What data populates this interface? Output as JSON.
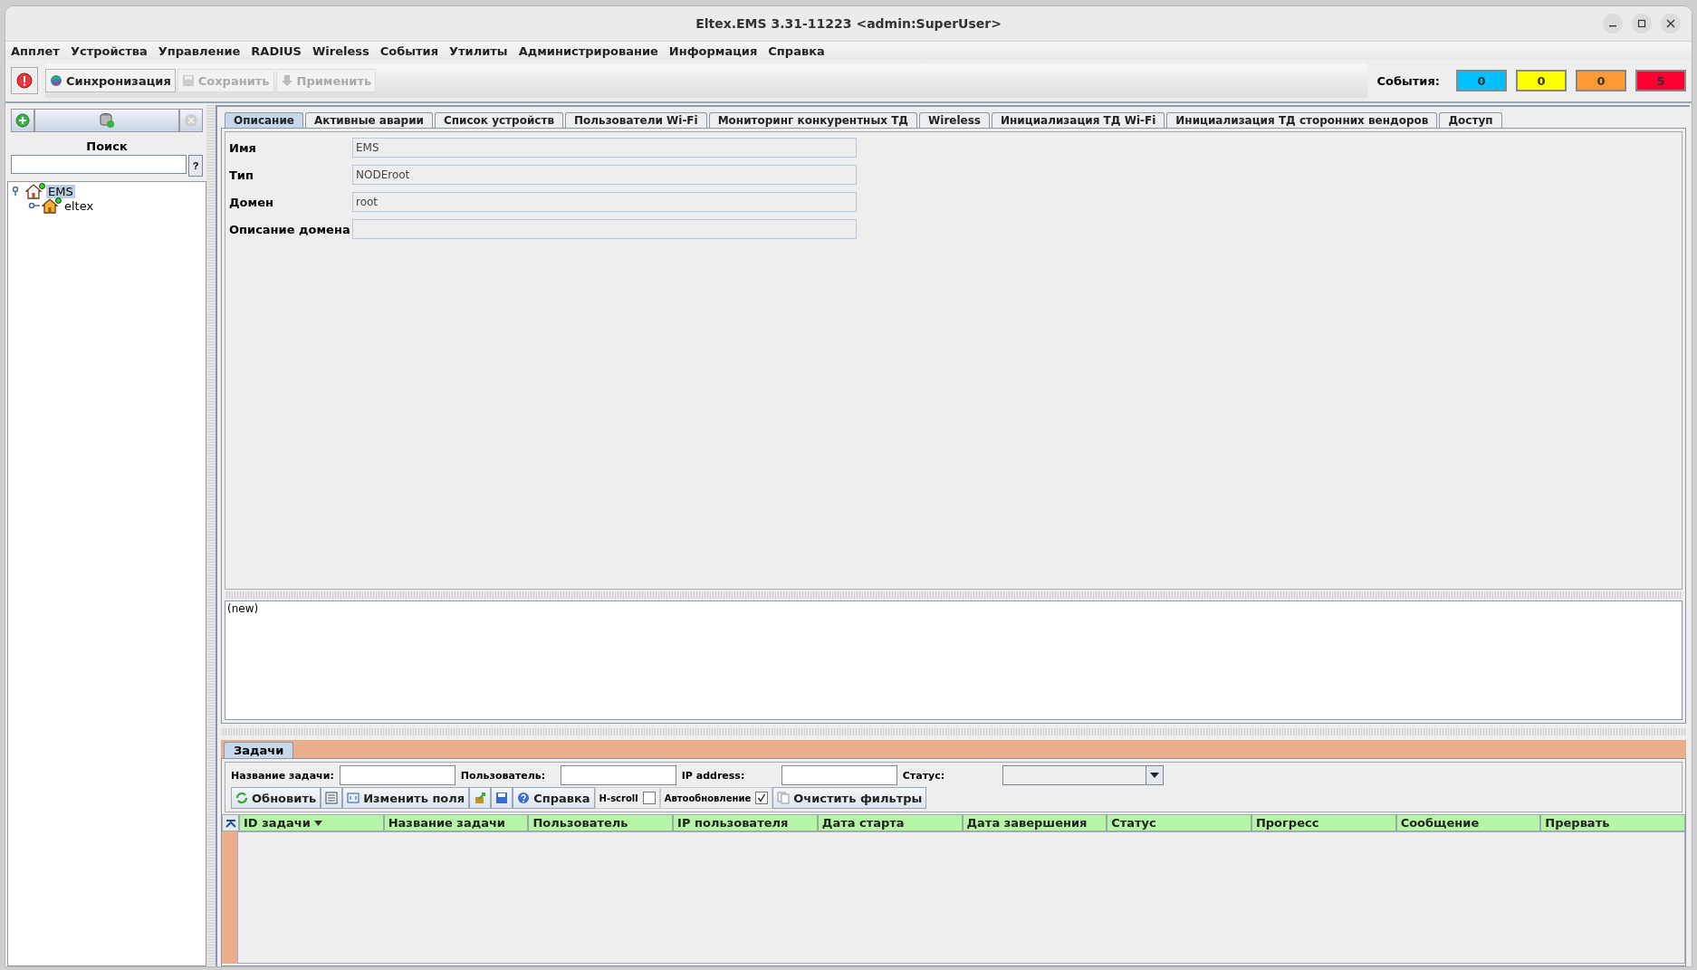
{
  "window": {
    "title": "Eltex.EMS 3.31-11223 <admin:SuperUser>"
  },
  "menu": [
    "Апплет",
    "Устройства",
    "Управление",
    "RADIUS",
    "Wireless",
    "События",
    "Утилиты",
    "Администрирование",
    "Информация",
    "Справка"
  ],
  "toolbar": [
    {
      "label": "Синхронизация",
      "disabled": false
    },
    {
      "label": "Сохранить",
      "disabled": true
    },
    {
      "label": "Применить",
      "disabled": true
    }
  ],
  "events": {
    "label": "События:",
    "counters": [
      {
        "value": "0",
        "color": "#00c0ff"
      },
      {
        "value": "0",
        "color": "#ffff00"
      },
      {
        "value": "0",
        "color": "#ff9933"
      },
      {
        "value": "5",
        "color": "#ff0033"
      }
    ]
  },
  "sidebar": {
    "search_label": "Поиск",
    "help_button": "?",
    "tree": [
      {
        "label": "EMS",
        "selected": true,
        "expanded": true,
        "children": [
          {
            "label": "eltex",
            "selected": false,
            "expanded": false
          }
        ]
      }
    ]
  },
  "tabs": [
    {
      "label": "Описание",
      "selected": true
    },
    {
      "label": "Активные аварии",
      "selected": false
    },
    {
      "label": "Список устройств",
      "selected": false
    },
    {
      "label": "Пользователи Wi-Fi",
      "selected": false
    },
    {
      "label": "Мониторинг конкурентных ТД",
      "selected": false
    },
    {
      "label": "Wireless",
      "selected": false
    },
    {
      "label": "Инициализация ТД Wi-Fi",
      "selected": false
    },
    {
      "label": "Инициализация ТД сторонних вендоров",
      "selected": false
    },
    {
      "label": "Доступ",
      "selected": false
    }
  ],
  "fields": [
    {
      "label": "Имя",
      "value": "EMS"
    },
    {
      "label": "Тип",
      "value": "NODEroot"
    },
    {
      "label": "Домен",
      "value": "root"
    },
    {
      "label": "Описание домена"
    }
  ],
  "notes": "(new)",
  "tasks": {
    "tab": "Задачи",
    "filters": [
      {
        "label": "Название задачи:",
        "kind": "text"
      },
      {
        "label": "Пользователь:",
        "kind": "text"
      },
      {
        "label": "IP address:",
        "kind": "text"
      },
      {
        "label": "Статус:",
        "kind": "select"
      }
    ],
    "buttons": [
      {
        "kind": "button",
        "label": "Обновить"
      },
      {
        "kind": "button"
      },
      {
        "kind": "button",
        "label": "Изменить поля"
      },
      {
        "kind": "button"
      },
      {
        "kind": "button"
      },
      {
        "kind": "button",
        "label": "Справка"
      },
      {
        "kind": "checkbox",
        "label": "H-scroll",
        "checked": false
      },
      {
        "kind": "checkbox",
        "label": "Автообновление",
        "checked": true
      },
      {
        "kind": "button",
        "label": "Очистить фильтры"
      }
    ],
    "columns": [
      {
        "label": "ID задачи",
        "sorted": true
      },
      {
        "label": "Название задачи",
        "sorted": false
      },
      {
        "label": "Пользователь",
        "sorted": false
      },
      {
        "label": "IP пользователя",
        "sorted": false
      },
      {
        "label": "Дата старта",
        "sorted": false
      },
      {
        "label": "Дата завершения",
        "sorted": false
      },
      {
        "label": "Статус",
        "sorted": false
      },
      {
        "label": "Прогресс",
        "sorted": false
      },
      {
        "label": "Сообщение",
        "sorted": false
      },
      {
        "label": "Прервать",
        "sorted": false
      }
    ]
  }
}
